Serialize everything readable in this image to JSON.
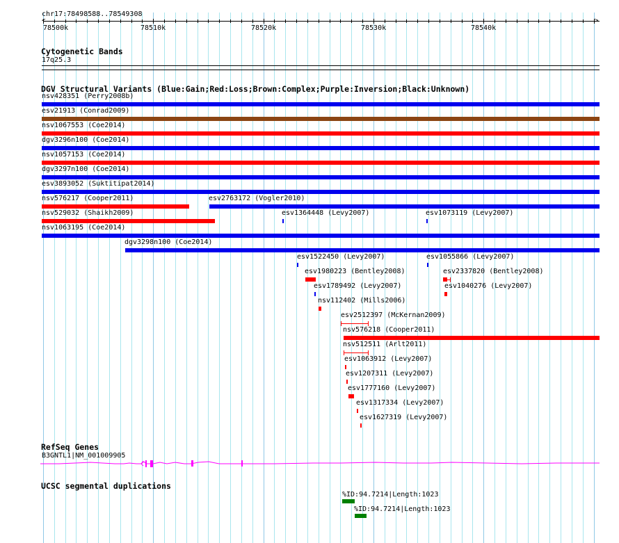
{
  "ruler": {
    "location": "chr17:78498588..78549308",
    "tick_labels": [
      "78500k",
      "78510k",
      "78520k",
      "78530k",
      "78540k"
    ]
  },
  "cytobands": {
    "title": "Cytogenetic Bands",
    "band": "17q25.3"
  },
  "dgv": {
    "title": "DGV Structural Variants (Blue:Gain;Red:Loss;Brown:Complex;Purple:Inversion;Black:Unknown)",
    "colors": {
      "gain": "#0000ee",
      "loss": "#ff0000",
      "complex": "#8b4513"
    },
    "features": [
      {
        "label": "nsv428351 (Perry2008b)",
        "type": "gain"
      },
      {
        "label": "esv21913 (Conrad2009)",
        "type": "complex"
      },
      {
        "label": "nsv1067553 (Coe2014)",
        "type": "loss"
      },
      {
        "label": "dgv3296n100 (Coe2014)",
        "type": "gain"
      },
      {
        "label": "nsv1057153 (Coe2014)",
        "type": "loss"
      },
      {
        "label": "dgv3297n100 (Coe2014)",
        "type": "gain"
      },
      {
        "label": "esv3893052 (Suktitipat2014)",
        "type": "gain"
      },
      {
        "label": "nsv576217 (Cooper2011)",
        "type": "loss"
      },
      {
        "label": "esv2763172 (Vogler2010)",
        "type": "gain"
      },
      {
        "label": "nsv529032 (Shaikh2009)",
        "type": "loss"
      },
      {
        "label": "esv1364448 (Levy2007)",
        "type": "gain"
      },
      {
        "label": "esv1073119 (Levy2007)",
        "type": "gain"
      },
      {
        "label": "nsv1063195 (Coe2014)",
        "type": "gain"
      },
      {
        "label": "dgv3298n100 (Coe2014)",
        "type": "gain"
      },
      {
        "label": "esv1522450 (Levy2007)",
        "type": "gain"
      },
      {
        "label": "esv1055866 (Levy2007)",
        "type": "gain"
      },
      {
        "label": "esv1980223 (Bentley2008)",
        "type": "loss"
      },
      {
        "label": "esv2337820 (Bentley2008)",
        "type": "loss"
      },
      {
        "label": "esv1789492 (Levy2007)",
        "type": "gain"
      },
      {
        "label": "esv1040276 (Levy2007)",
        "type": "loss"
      },
      {
        "label": "nsv112402 (Mills2006)",
        "type": "loss"
      },
      {
        "label": "esv2512397 (McKernan2009)",
        "type": "loss"
      },
      {
        "label": "nsv576218 (Cooper2011)",
        "type": "loss"
      },
      {
        "label": "nsv512511 (Arlt2011)",
        "type": "loss"
      },
      {
        "label": "esv1063912 (Levy2007)",
        "type": "loss"
      },
      {
        "label": "esv1207311 (Levy2007)",
        "type": "loss"
      },
      {
        "label": "esv1777160 (Levy2007)",
        "type": "loss"
      },
      {
        "label": "esv1317334 (Levy2007)",
        "type": "loss"
      },
      {
        "label": "esv1627319 (Levy2007)",
        "type": "loss"
      }
    ]
  },
  "refseq": {
    "title": "RefSeq Genes",
    "gene": "B3GNTL1|NM_001009905",
    "color": "#ff00ff"
  },
  "segdups": {
    "title": "UCSC segmental duplications",
    "color": "#008000",
    "features": [
      {
        "label": "%ID:94.7214|Length:1023"
      },
      {
        "label": "%ID:94.7214|Length:1023"
      }
    ]
  }
}
